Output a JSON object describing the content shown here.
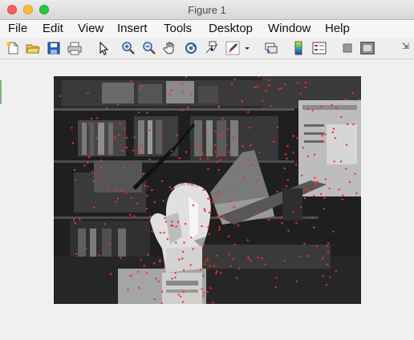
{
  "window": {
    "title": "Figure 1"
  },
  "menu": [
    "File",
    "Edit",
    "View",
    "Insert",
    "Tools",
    "Desktop",
    "Window",
    "Help"
  ],
  "toolbar": {
    "buttons": [
      "new-figure",
      "open-file",
      "save-figure",
      "print-figure",
      "pointer",
      "zoom-in",
      "zoom-out",
      "pan",
      "rotate-3d",
      "data-cursor",
      "brush",
      "brush-dropdown",
      "link-plot",
      "insert-colorbar",
      "insert-legend",
      "hide-plot-tools",
      "show-plot-tools"
    ]
  },
  "colors": {
    "marker": "#ff2a2a",
    "close": "#fc5f57",
    "minimize": "#fdbc2e",
    "maximize": "#28c840"
  }
}
